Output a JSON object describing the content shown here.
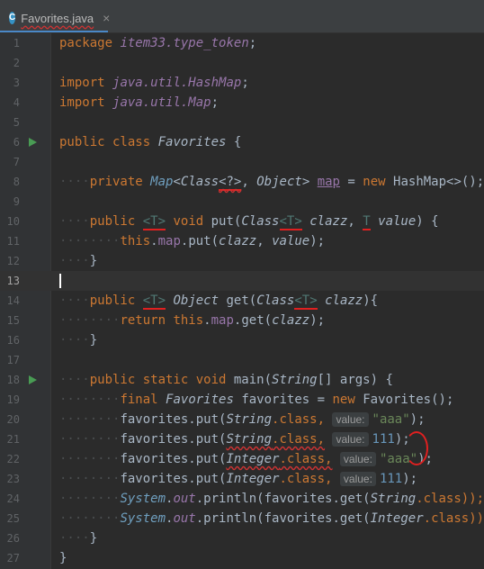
{
  "tab": {
    "label": "Favorites.java",
    "icon": "java-class-icon",
    "close": "×"
  },
  "line_numbers": [
    "1",
    "2",
    "3",
    "4",
    "5",
    "6",
    "7",
    "8",
    "9",
    "10",
    "11",
    "12",
    "13",
    "14",
    "15",
    "16",
    "17",
    "18",
    "19",
    "20",
    "21",
    "22",
    "23",
    "24",
    "25",
    "26",
    "27"
  ],
  "code": {
    "l1": [
      "package",
      "item33.type_token",
      ";"
    ],
    "l3": [
      "import",
      "java.util.HashMap",
      ";"
    ],
    "l4": [
      "import",
      "java.util.Map",
      ";"
    ],
    "l6": [
      "public class",
      "Favorites",
      "{"
    ],
    "l8": [
      "private",
      "Map",
      "<",
      "Class",
      "<?>",
      ",",
      "Object",
      ">",
      "map",
      "=",
      "new",
      "HashMap<>",
      "();"
    ],
    "l10": [
      "public",
      "<T>",
      "void",
      "put(",
      "Class",
      "<T>",
      "clazz",
      ",",
      "T",
      "value",
      ") {"
    ],
    "l11": [
      "this",
      ".",
      "map",
      ".put(",
      "clazz",
      ",",
      "value",
      ");"
    ],
    "l12": [
      "}"
    ],
    "l14": [
      "public",
      "<T>",
      "Object",
      "get(",
      "Class",
      "<T>",
      "clazz",
      "){"
    ],
    "l15": [
      "return",
      "this",
      ".",
      "map",
      ".get(",
      "clazz",
      ");"
    ],
    "l16": [
      "}"
    ],
    "l18": [
      "public static void",
      "main(",
      "String",
      "[] args) {"
    ],
    "l19": [
      "final",
      "Favorites",
      "favorites",
      "=",
      "new",
      "Favorites",
      "();"
    ],
    "l20": [
      "favorites.put(",
      "String",
      ".class,",
      "value:",
      "\"aaa\"",
      ");"
    ],
    "l21": [
      "favorites.put(",
      "String",
      ".class,",
      "value:",
      "111",
      ");"
    ],
    "l22": [
      "favorites.put(",
      "Integer",
      ".class,",
      "value:",
      "\"aaa\"",
      ");"
    ],
    "l23": [
      "favorites.put(",
      "Integer",
      ".class,",
      "value:",
      "111",
      ");"
    ],
    "l24": [
      "System",
      ".",
      "out",
      ".println(favorites.get(",
      "String",
      ".class));"
    ],
    "l25": [
      "System",
      ".",
      "out",
      ".println(favorites.get(",
      "Integer",
      ".class));"
    ],
    "l26": [
      "}"
    ],
    "l27": [
      "}"
    ]
  },
  "colors": {
    "background": "#2b2b2b",
    "keyword": "#cc7832",
    "string": "#6a8759",
    "number": "#6897bb",
    "field": "#9876aa",
    "annotation_red": "#e02020"
  }
}
